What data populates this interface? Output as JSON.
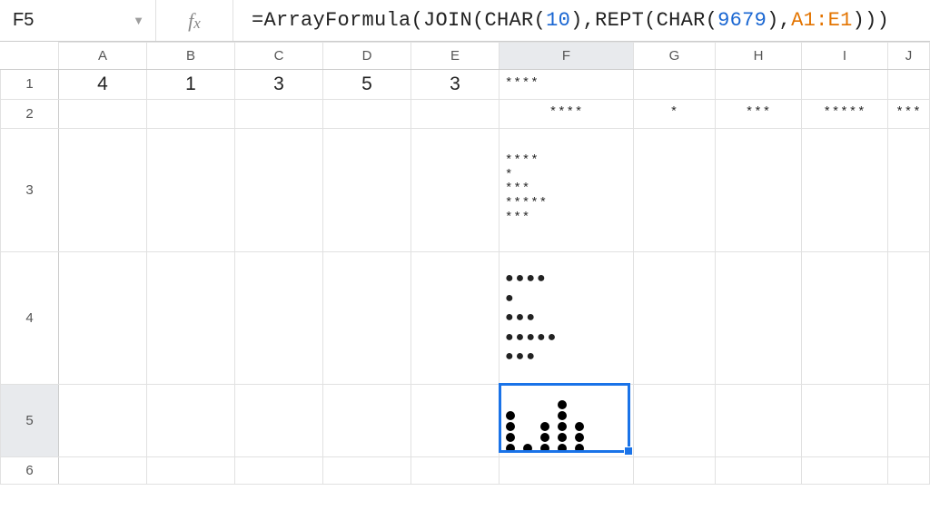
{
  "name_box": "F5",
  "formula_display": {
    "p0": "=ArrayFormula(JOIN(CHAR(",
    "n1": "10",
    "p1": "),REPT(CHAR(",
    "n2": "9679",
    "p2": "),",
    "ref": "A1:E1",
    "p3": ")))"
  },
  "columns": [
    "A",
    "B",
    "C",
    "D",
    "E",
    "F",
    "G",
    "H",
    "I",
    "J"
  ],
  "row_headers": [
    "1",
    "2",
    "3",
    "4",
    "5",
    "6"
  ],
  "selected_column": "F",
  "selected_row": "5",
  "cells": {
    "A1": "4",
    "B1": "1",
    "C1": "3",
    "D1": "5",
    "E1": "3",
    "F1": "****",
    "F2": "****",
    "G2": "*",
    "H2": "***",
    "I2": "*****",
    "J2": "***",
    "F3_lines": [
      "****",
      "*",
      "***",
      "*****",
      "***"
    ],
    "F4_lines": [
      "●●●●",
      "●",
      "●●●",
      "●●●●●",
      "●●●"
    ],
    "F5_bar_values": [
      4,
      1,
      3,
      5,
      3
    ]
  },
  "chart_data": {
    "type": "bar",
    "categories": [
      "A",
      "B",
      "C",
      "D",
      "E"
    ],
    "values": [
      4,
      1,
      3,
      5,
      3
    ],
    "title": "",
    "xlabel": "",
    "ylabel": "",
    "ylim": [
      0,
      5
    ],
    "note": "In-cell sparkline built from REPT of CHAR(9679) joined by CHAR(10); visually a column chart of dot stacks"
  },
  "active_cell": "F5"
}
